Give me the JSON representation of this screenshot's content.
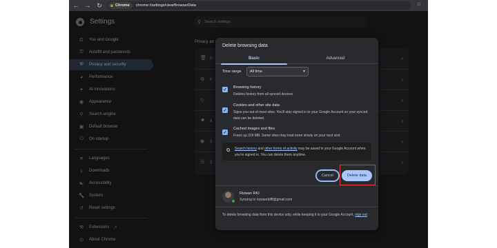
{
  "toolbar": {
    "back_icon": "arrow-left-icon",
    "forward_icon": "arrow-right-icon",
    "reload_icon": "reload-icon",
    "chip_label": "Chrome",
    "url": "chrome://settings/clearBrowserData",
    "bookmark_icon": "star-icon"
  },
  "settings": {
    "title": "Settings",
    "search_placeholder": "Search settings"
  },
  "sidebar": {
    "items": [
      {
        "label": "You and Google",
        "icon": "google-g-icon"
      },
      {
        "label": "Autofill and passwords",
        "icon": "key-icon"
      },
      {
        "label": "Privacy and security",
        "icon": "shield-icon"
      },
      {
        "label": "Performance",
        "icon": "speedometer-icon"
      },
      {
        "label": "AI innovations",
        "icon": "sparkle-icon"
      },
      {
        "label": "Appearance",
        "icon": "palette-icon"
      },
      {
        "label": "Search engine",
        "icon": "search-icon"
      },
      {
        "label": "Default browser",
        "icon": "browser-icon"
      },
      {
        "label": "On startup",
        "icon": "power-icon"
      },
      {
        "label": "Languages",
        "icon": "language-icon"
      },
      {
        "label": "Downloads",
        "icon": "download-icon"
      },
      {
        "label": "Accessibility",
        "icon": "accessibility-icon"
      },
      {
        "label": "System",
        "icon": "wrench-icon"
      },
      {
        "label": "Reset settings",
        "icon": "reset-icon"
      },
      {
        "label": "Extensions",
        "icon": "puzzle-icon"
      },
      {
        "label": "About Chrome",
        "icon": "chrome-icon"
      }
    ],
    "active_index": 2
  },
  "background": {
    "section_label": "Privacy and security"
  },
  "dialog": {
    "title": "Delete browsing data",
    "tabs": [
      "Basic",
      "Advanced"
    ],
    "time_range_label": "Time range",
    "time_range_value": "All time",
    "options": [
      {
        "title": "Browsing history",
        "desc": "Deletes history from all synced devices",
        "checked": true
      },
      {
        "title": "Cookies and other site data",
        "desc": "Signs you out of most sites. You'll stay signed in to your Google Account so your synced data can be deleted.",
        "checked": true
      },
      {
        "title": "Cached images and files",
        "desc": "Frees up 319 MB. Some sites may load more slowly on your next visit.",
        "checked": true
      }
    ],
    "info": {
      "link1": "Search history",
      "mid1": " and ",
      "link2": "other forms of activity",
      "rest": " may be saved in your Google Account when you're signed in. You can delete them anytime."
    },
    "cancel_label": "Cancel",
    "delete_label": "Delete data",
    "account": {
      "name": "Rizwan RKI",
      "sync": "Syncing to rizwanrkifff@gmail.com"
    },
    "footer": {
      "text": "To delete browsing data from this device only, while keeping it in your Google Account, ",
      "link": "sign out",
      "end": "."
    }
  },
  "colors": {
    "accent": "#a8c7fa",
    "highlight": "#e53935",
    "dialog_bg": "#292a2d"
  }
}
